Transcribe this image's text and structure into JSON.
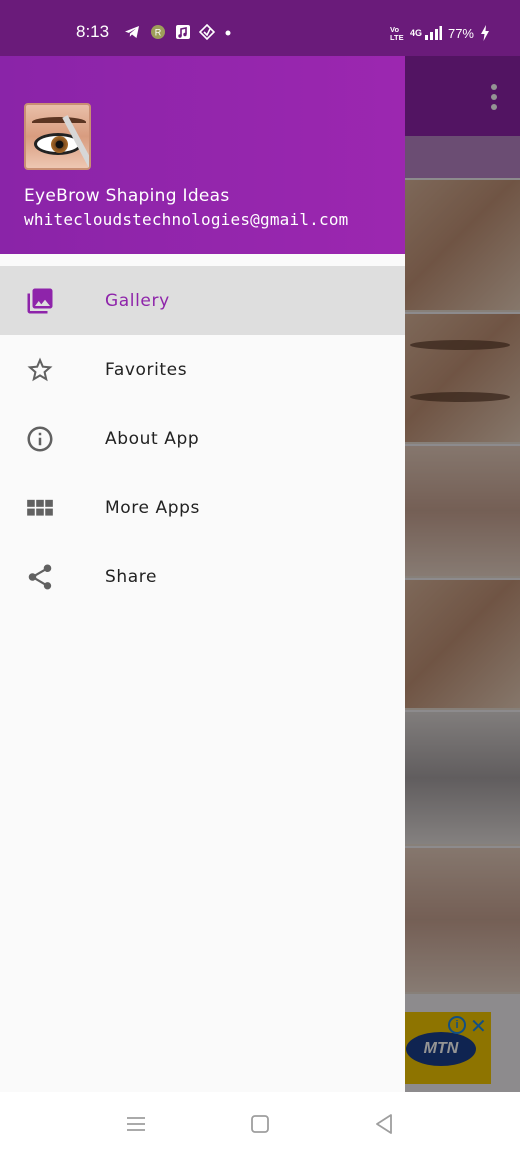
{
  "status_bar": {
    "time": "8:13",
    "network": "4G",
    "battery": "77%"
  },
  "drawer": {
    "app_name": "EyeBrow Shaping Ideas",
    "email": "whitecloudstechnologies@gmail.com",
    "items": [
      {
        "label": "Gallery",
        "icon": "gallery-icon",
        "active": true
      },
      {
        "label": "Favorites",
        "icon": "star-icon",
        "active": false
      },
      {
        "label": "About App",
        "icon": "info-icon",
        "active": false
      },
      {
        "label": "More Apps",
        "icon": "grid-icon",
        "active": false
      },
      {
        "label": "Share",
        "icon": "share-icon",
        "active": false
      }
    ]
  },
  "ad": {
    "brand": "MTN"
  },
  "colors": {
    "primary": "#8e24aa",
    "status_bar": "#6a1b7a",
    "active_item_bg": "#dedede"
  }
}
